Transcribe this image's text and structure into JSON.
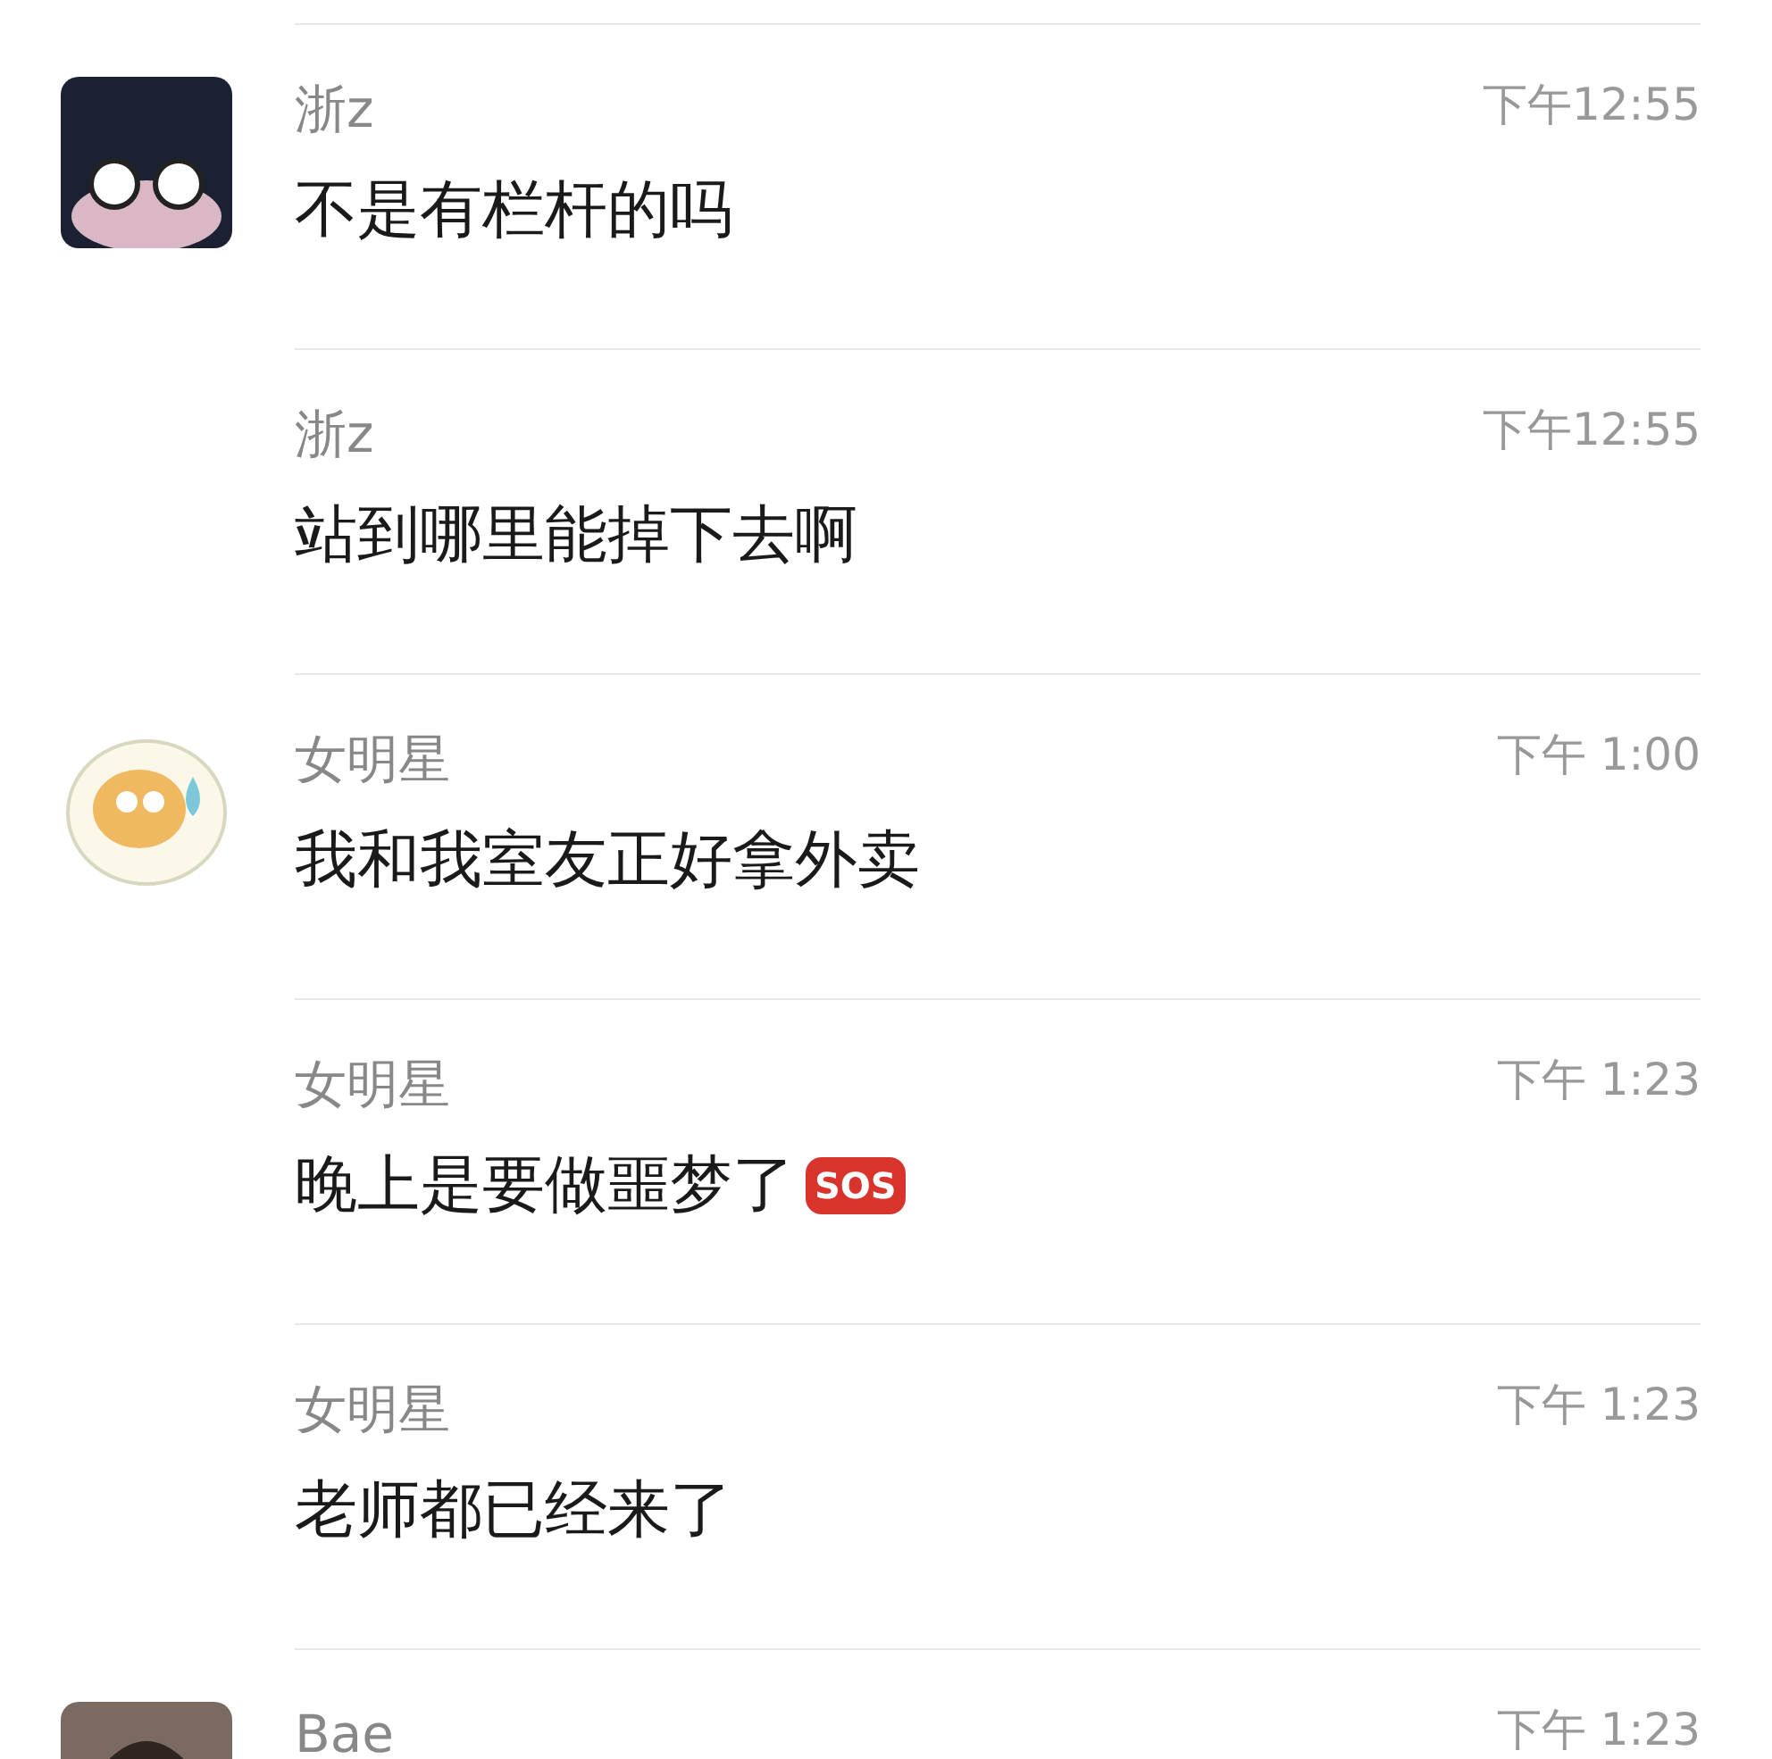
{
  "messages": [
    {
      "sender": "浙z",
      "time": "下午12:55",
      "text": "不是有栏杆的吗",
      "avatar": true
    },
    {
      "sender": "浙z",
      "time": "下午12:55",
      "text": "站到哪里能掉下去啊",
      "avatar": false
    },
    {
      "sender": "女明星",
      "time": "下午 1:00",
      "text": "我和我室友正好拿外卖",
      "avatar": true
    },
    {
      "sender": "女明星",
      "time": "下午 1:23",
      "text": "晚上是要做噩梦了",
      "badge": "SOS",
      "avatar": false
    },
    {
      "sender": "女明星",
      "time": "下午 1:23",
      "text": "老师都已经来了",
      "avatar": false
    },
    {
      "sender": "Bae",
      "time": "下午 1:23",
      "avatar": true
    }
  ]
}
